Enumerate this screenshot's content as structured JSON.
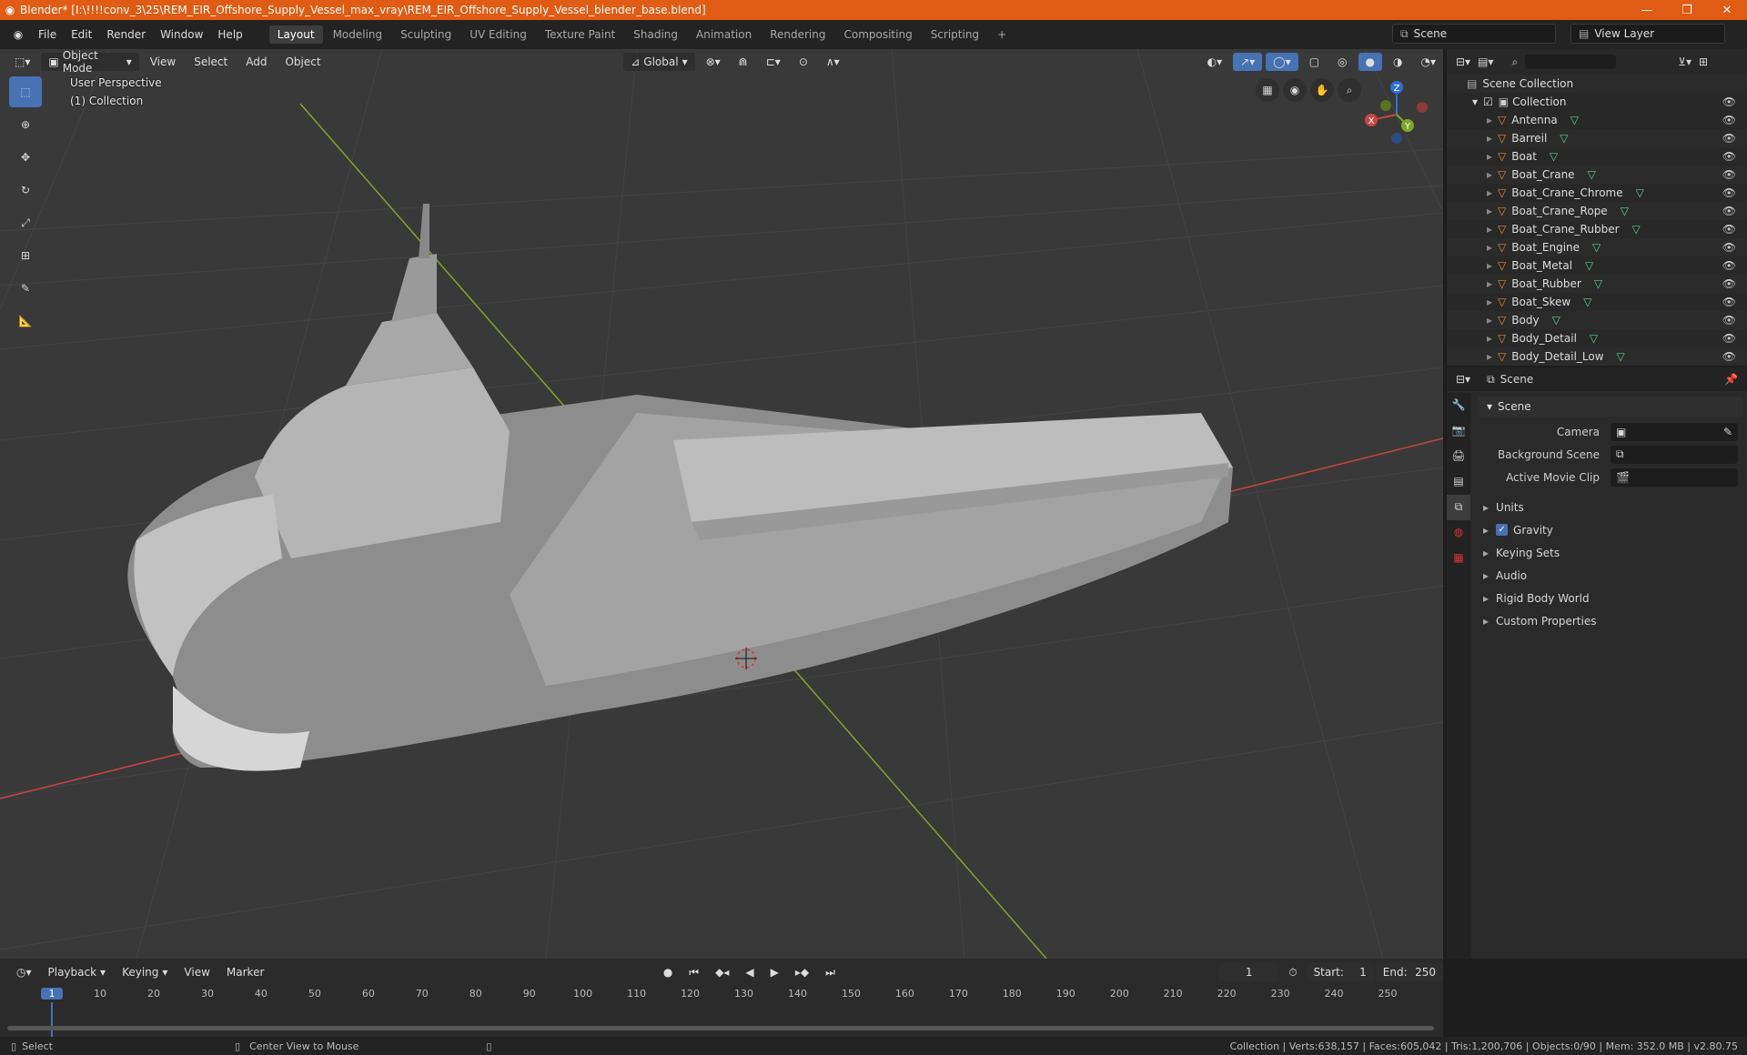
{
  "titlebar": {
    "title": "Blender* [I:\\!!!!conv_3\\25\\REM_EIR_Offshore_Supply_Vessel_max_vray\\REM_EIR_Offshore_Supply_Vessel_blender_base.blend]",
    "minimize": "—",
    "maximize": "❐",
    "close": "✕"
  },
  "menubar": {
    "menus": [
      "File",
      "Edit",
      "Render",
      "Window",
      "Help"
    ],
    "workspaces": [
      "Layout",
      "Modeling",
      "Sculpting",
      "UV Editing",
      "Texture Paint",
      "Shading",
      "Animation",
      "Rendering",
      "Compositing",
      "Scripting"
    ],
    "active_workspace": "Layout",
    "add_tab": "+",
    "scene": "Scene",
    "view_layer": "View Layer"
  },
  "viewport": {
    "mode": "Object Mode",
    "menus": [
      "View",
      "Select",
      "Add",
      "Object"
    ],
    "orientation": "Global",
    "info_line1": "User Perspective",
    "info_line2": "(1) Collection",
    "gizmo": {
      "x": "X",
      "y": "Y",
      "z": "Z"
    }
  },
  "outliner": {
    "root": "Scene Collection",
    "collection": "Collection",
    "items": [
      "Antenna",
      "Barreil",
      "Boat",
      "Boat_Crane",
      "Boat_Crane_Chrome",
      "Boat_Crane_Rope",
      "Boat_Crane_Rubber",
      "Boat_Engine",
      "Boat_Metal",
      "Boat_Rubber",
      "Boat_Skew",
      "Body",
      "Body_Detail",
      "Body_Detail_Low"
    ]
  },
  "properties": {
    "header": "Scene",
    "panel": "Scene",
    "camera_label": "Camera",
    "bg_scene_label": "Background Scene",
    "movie_clip_label": "Active Movie Clip",
    "subpanels": [
      "Units",
      "Gravity",
      "Keying Sets",
      "Audio",
      "Rigid Body World",
      "Custom Properties"
    ],
    "gravity_checked": true
  },
  "timeline": {
    "menus": [
      "Playback",
      "Keying",
      "View",
      "Marker"
    ],
    "current_frame": "1",
    "start_label": "Start:",
    "start": "1",
    "end_label": "End:",
    "end": "250",
    "ruler": [
      "1",
      "10",
      "20",
      "30",
      "40",
      "50",
      "60",
      "70",
      "80",
      "90",
      "100",
      "110",
      "120",
      "130",
      "140",
      "150",
      "160",
      "170",
      "180",
      "190",
      "200",
      "210",
      "220",
      "230",
      "240",
      "250"
    ]
  },
  "statusbar": {
    "select": "Select",
    "center": "Center View to Mouse",
    "stats": "Collection | Verts:638,157 | Faces:605,042 | Tris:1,200,706 | Objects:0/90 | Mem: 352.0 MB | v2.80.75"
  },
  "colors": {
    "accent": "#4772b3",
    "title_bar": "#e05b13",
    "x_axis": "#c8453f",
    "y_axis": "#7fa52a",
    "object_orange": "#e7892f",
    "mesh_green": "#5bd08d"
  }
}
